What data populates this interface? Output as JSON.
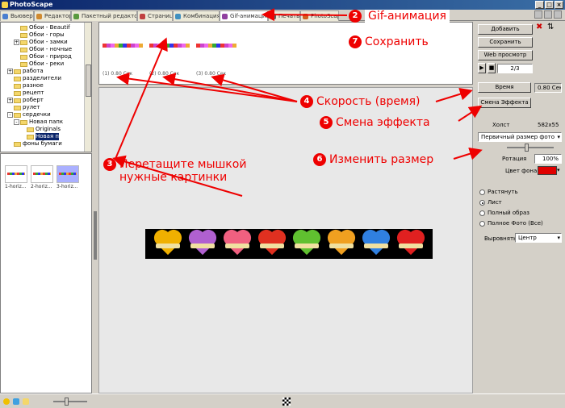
{
  "app": {
    "title": "PhotoScape"
  },
  "tabs": [
    {
      "label": "Вьювер",
      "color": "#4a7fd0"
    },
    {
      "label": "Редактор",
      "color": "#d08a30"
    },
    {
      "label": "Пакетный редактор",
      "color": "#5a9a40"
    },
    {
      "label": "Страница",
      "color": "#c04040"
    },
    {
      "label": "Комбинация",
      "color": "#4090c0"
    },
    {
      "label": "Gif-анимация",
      "color": "#9040a0",
      "active": true
    },
    {
      "label": "Печать",
      "color": "#606060"
    },
    {
      "label": "PhotoScape",
      "color": "#d06020"
    }
  ],
  "tree": {
    "items": [
      {
        "label": "Обои - Beautif",
        "level": 2
      },
      {
        "label": "Обои - горы",
        "level": 2
      },
      {
        "label": "Обои - замки",
        "level": 2,
        "expander": "+"
      },
      {
        "label": "Обои - ночные",
        "level": 2
      },
      {
        "label": "Обои - природ",
        "level": 2
      },
      {
        "label": "Обои - реки",
        "level": 2
      },
      {
        "label": "работа",
        "level": 1,
        "expander": "+"
      },
      {
        "label": "разделители",
        "level": 1
      },
      {
        "label": "разное",
        "level": 1
      },
      {
        "label": "рецепт",
        "level": 1
      },
      {
        "label": "роберт",
        "level": 1,
        "expander": "+"
      },
      {
        "label": "рулет",
        "level": 1
      },
      {
        "label": "сердечки",
        "level": 1,
        "expander": "-"
      },
      {
        "label": "Новая папк",
        "level": 2,
        "expander": "-"
      },
      {
        "label": "Originals",
        "level": 3
      },
      {
        "label": "Новая п",
        "level": 3,
        "selected": true
      },
      {
        "label": "фоны бумаги",
        "level": 1
      }
    ]
  },
  "thumbnails": [
    {
      "caption": "1-horiz..."
    },
    {
      "caption": "2-horiz..."
    },
    {
      "caption": "3-horiz...",
      "selected": true
    }
  ],
  "frames": [
    {
      "caption": "(1) 0.80 Сек"
    },
    {
      "caption": "(2) 0.80 Сек"
    },
    {
      "caption": "(3) 0.80 Сек"
    }
  ],
  "hearts": [
    "#f0b000",
    "#b060d0",
    "#f06080",
    "#e03020",
    "#60c030",
    "#f0a020",
    "#3080e0",
    "#e02020"
  ],
  "right_panel": {
    "add_label": "Добавить",
    "save_label": "Сохранить",
    "preview_label": "Web просмотр",
    "frame_counter": "2/3",
    "time_label": "Время",
    "time_value": "0.80 Сек",
    "effect_label": "Смена Эффекта",
    "size_label": "Холст",
    "size_value": "582x55",
    "size_mode": "Первичный размер фото",
    "rotation_label": "Ротация",
    "rotation_value": "100%",
    "bg_color_label": "Цвет фона",
    "bg_color": "#e00000",
    "radios": [
      {
        "label": "Растянуть",
        "checked": false
      },
      {
        "label": "Лист",
        "checked": true
      },
      {
        "label": "Полный образ",
        "checked": false
      },
      {
        "label": "Полное Фото (Все)",
        "checked": false
      }
    ],
    "align_label": "Выровнять",
    "align_value": "Центр"
  },
  "annotations": {
    "a2": {
      "num": "2",
      "text": "Gif-анимация"
    },
    "a7": {
      "num": "7",
      "text": "Сохранить"
    },
    "a3": {
      "num": "3",
      "line1": "Перетащите мышкой",
      "line2": "нужные картинки"
    },
    "a4": {
      "num": "4",
      "text": "Скорость (время)"
    },
    "a5": {
      "num": "5",
      "text": "Смена эффекта"
    },
    "a6": {
      "num": "6",
      "text": "Изменить размер"
    }
  }
}
